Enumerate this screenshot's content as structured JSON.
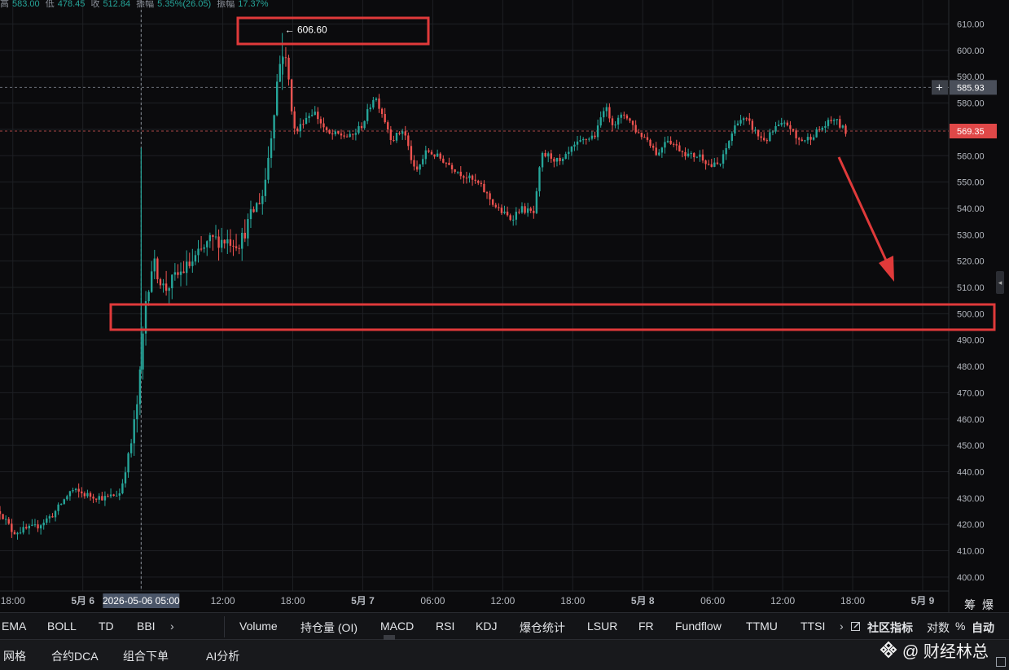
{
  "ohlc": {
    "high_label": "高",
    "high": "583.00",
    "low_label": "低",
    "low": "478.45",
    "close_label": "收",
    "close": "512.84",
    "change_label": "振幅",
    "change": "5.35%(26.05)",
    "amplitude_label": "振幅",
    "amplitude": "17.37%"
  },
  "colors": {
    "up": "#26a69a",
    "down": "#ef5350",
    "annotation": "#e03a3a",
    "background": "#0b0b0d"
  },
  "chart_data": {
    "type": "candlestick",
    "y_ticks": [
      "610.00",
      "600.00",
      "590.00",
      "580.00",
      "570.00",
      "560.00",
      "550.00",
      "540.00",
      "530.00",
      "520.00",
      "510.00",
      "500.00",
      "490.00",
      "480.00",
      "470.00",
      "460.00",
      "450.00",
      "440.00",
      "430.00",
      "420.00",
      "410.00",
      "400.00"
    ],
    "ylim": [
      397,
      614
    ],
    "x_labels": [
      {
        "label": "18:00",
        "t": 0
      },
      {
        "label": "5月 6",
        "t": 6
      },
      {
        "label": "2026-05-06 05:00",
        "t": 11,
        "highlight": true
      },
      {
        "label": "12:00",
        "t": 18
      },
      {
        "label": "18:00",
        "t": 24
      },
      {
        "label": "5月 7",
        "t": 30
      },
      {
        "label": "06:00",
        "t": 36
      },
      {
        "label": "12:00",
        "t": 42
      },
      {
        "label": "18:00",
        "t": 48
      },
      {
        "label": "5月 8",
        "t": 54
      },
      {
        "label": "06:00",
        "t": 60
      },
      {
        "label": "12:00",
        "t": 66
      },
      {
        "label": "18:00",
        "t": 72
      },
      {
        "label": "5月 9",
        "t": 78
      }
    ],
    "x_range_hours": [
      -1.1,
      85.4
    ],
    "crosshair_t": 11,
    "price_lines": [
      {
        "value": 585.93,
        "label": "585.93",
        "color": "#4a4f5a",
        "text": "#ffffff",
        "style": "crosshair"
      },
      {
        "value": 569.35,
        "label": "569.35",
        "color": "#e04848",
        "text": "#ffffff",
        "style": "last"
      }
    ],
    "peak": {
      "value": "606.60",
      "prefix": "← "
    },
    "waypoints": [
      [
        -1.1,
        425
      ],
      [
        0,
        417
      ],
      [
        2,
        419
      ],
      [
        3.5,
        424
      ],
      [
        5,
        433
      ],
      [
        6.5,
        431
      ],
      [
        8,
        430
      ],
      [
        9.2,
        432
      ],
      [
        10.2,
        452
      ],
      [
        10.8,
        470
      ],
      [
        11.05,
        486
      ],
      [
        11.4,
        505
      ],
      [
        12,
        520
      ],
      [
        13,
        509
      ],
      [
        14,
        514
      ],
      [
        15.5,
        520
      ],
      [
        17,
        528
      ],
      [
        18.5,
        528
      ],
      [
        19.5,
        527
      ],
      [
        20.5,
        538
      ],
      [
        21.5,
        546
      ],
      [
        22.2,
        570
      ],
      [
        22.7,
        590
      ],
      [
        23.1,
        600
      ],
      [
        23.5,
        594
      ],
      [
        24.2,
        568
      ],
      [
        25,
        574
      ],
      [
        25.8,
        577
      ],
      [
        27,
        568
      ],
      [
        28,
        568
      ],
      [
        29,
        567
      ],
      [
        30,
        572
      ],
      [
        31,
        583
      ],
      [
        31.6,
        577
      ],
      [
        32.5,
        566
      ],
      [
        33.5,
        570
      ],
      [
        34.5,
        553
      ],
      [
        35.5,
        562
      ],
      [
        37,
        558
      ],
      [
        38.5,
        553
      ],
      [
        40,
        549
      ],
      [
        41.5,
        540
      ],
      [
        42.7,
        536
      ],
      [
        43.5,
        540
      ],
      [
        44.7,
        538
      ],
      [
        45.3,
        560
      ],
      [
        46,
        560
      ],
      [
        47,
        557
      ],
      [
        48,
        563
      ],
      [
        49,
        566
      ],
      [
        50,
        568
      ],
      [
        50.7,
        579
      ],
      [
        51.5,
        572
      ],
      [
        52.5,
        576
      ],
      [
        53.5,
        569
      ],
      [
        54.5,
        566
      ],
      [
        55.3,
        560
      ],
      [
        56,
        567
      ],
      [
        57,
        563
      ],
      [
        58,
        560
      ],
      [
        59,
        560
      ],
      [
        59.8,
        556
      ],
      [
        60.7,
        557
      ],
      [
        61.5,
        567
      ],
      [
        62.2,
        574
      ],
      [
        63,
        573
      ],
      [
        64,
        567
      ],
      [
        64.6,
        566
      ],
      [
        65.5,
        571
      ],
      [
        66.5,
        572
      ],
      [
        67.2,
        566
      ],
      [
        68,
        566
      ],
      [
        69.5,
        571
      ],
      [
        70.4,
        574
      ],
      [
        71.4,
        569
      ]
    ]
  },
  "indicators": {
    "left": [
      "EMA",
      "BOLL",
      "TD",
      "BBI"
    ],
    "more_left": "›",
    "right": [
      "Volume",
      "持仓量 (OI)",
      "MACD",
      "RSI",
      "KDJ",
      "爆仓统计",
      "LSUR",
      "FR",
      "Fundflow",
      "TTMU",
      "TTSI"
    ],
    "more_right": "›",
    "community": "社区指标",
    "log": "对数",
    "percent": "%",
    "auto": "自动",
    "chip": "筹",
    "liq": "爆"
  },
  "bottom": {
    "items": [
      "网格",
      "合约DCA",
      "组合下单",
      "AI分析"
    ]
  },
  "watermark": {
    "text": "@ 财经林总"
  }
}
